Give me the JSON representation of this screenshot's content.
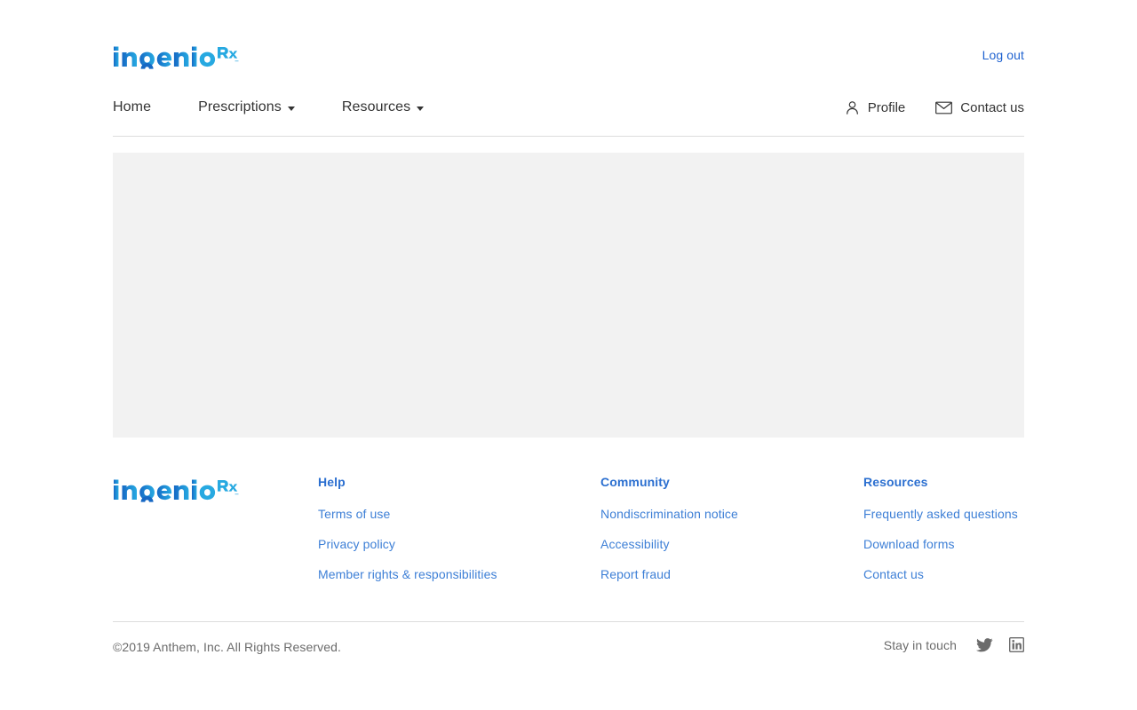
{
  "brand": {
    "logo_text": "ingenio",
    "logo_superscript": "Rx",
    "logo_alt": "IngenioRx",
    "color_dark": "#1668c4",
    "color_light": "#27a9e1"
  },
  "utility": {
    "logout_label": "Log out",
    "logout_color": "#1f62d0"
  },
  "nav": {
    "items": [
      {
        "label": "Home",
        "has_caret": false
      },
      {
        "label": "Prescriptions",
        "has_caret": true
      },
      {
        "label": "Resources",
        "has_caret": true
      }
    ],
    "utilities": [
      {
        "label": "Profile",
        "icon": "person-icon"
      },
      {
        "label": "Contact us",
        "icon": "envelope-icon"
      }
    ]
  },
  "content": {
    "placeholder_color": "#f2f2f2"
  },
  "footer": {
    "columns": [
      {
        "heading": "Help",
        "links": [
          "Terms of use",
          "Privacy policy",
          "Member rights & responsibilities"
        ]
      },
      {
        "heading": "Community",
        "links": [
          "Nondiscrimination notice",
          "Accessibility",
          "Report fraud"
        ]
      },
      {
        "heading": "Resources",
        "links": [
          "Frequently asked questions",
          "Download forms",
          "Contact us"
        ]
      }
    ],
    "heading_color": "#2b6fd0",
    "link_color": "#3d7fd6"
  },
  "bottom": {
    "copyright": "©2019 Anthem, Inc. All Rights Reserved.",
    "social_label": "Stay in touch",
    "social_links": [
      {
        "name": "twitter-icon"
      },
      {
        "name": "linkedin-icon"
      }
    ],
    "text_color": "#6b6b6b"
  }
}
